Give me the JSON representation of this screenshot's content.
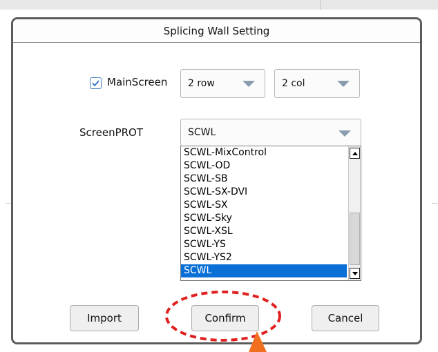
{
  "dialog": {
    "title": "Splicing Wall Setting"
  },
  "main_screen": {
    "label": "MainScreen",
    "checked": true,
    "rows_value": "2 row",
    "cols_value": "2 col"
  },
  "screen_prot": {
    "label": "ScreenPROT",
    "selected_value": "SCWL",
    "options": [
      "SCWL-MixControl",
      "SCWL-OD",
      "SCWL-SB",
      "SCWL-SX-DVI",
      "SCWL-SX",
      "SCWL-Sky",
      "SCWL-XSL",
      "SCWL-YS",
      "SCWL-YS2",
      "SCWL"
    ],
    "highlighted_index": 9
  },
  "buttons": {
    "import_label": "Import",
    "confirm_label": "Confirm",
    "cancel_label": "Cancel"
  },
  "colors": {
    "selection": "#0a6fd6",
    "annotation": "#e02020",
    "arrow": "#f07020"
  }
}
